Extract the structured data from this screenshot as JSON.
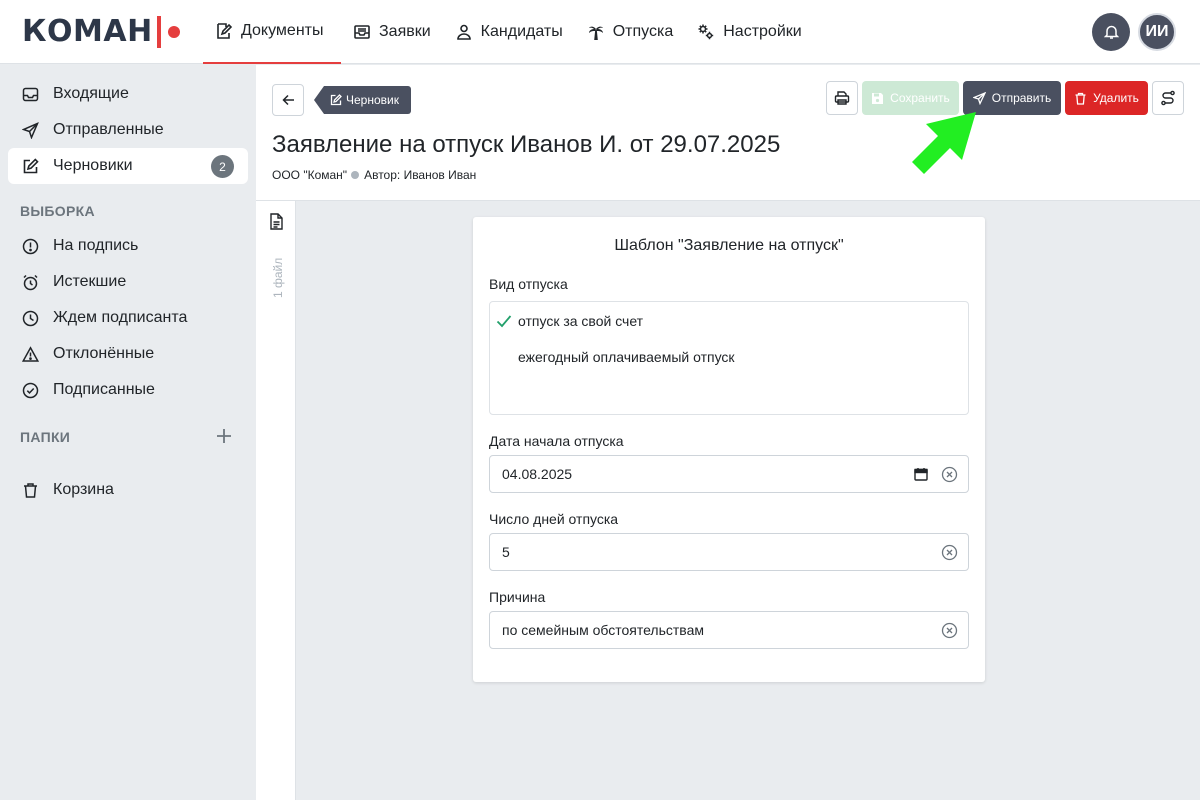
{
  "brand": {
    "logo_text": "КОМАН"
  },
  "nav": {
    "items": [
      {
        "label": "Документы",
        "icon": "document-edit-icon",
        "active": true
      },
      {
        "label": "Заявки",
        "icon": "inbox-icon"
      },
      {
        "label": "Кандидаты",
        "icon": "person-icon"
      },
      {
        "label": "Отпуска",
        "icon": "palm-tree-icon"
      },
      {
        "label": "Настройки",
        "icon": "gears-icon"
      }
    ]
  },
  "user": {
    "initials": "ИИ"
  },
  "sidebar": {
    "items": [
      {
        "label": "Входящие",
        "icon": "inbox-icon"
      },
      {
        "label": "Отправленные",
        "icon": "send-icon"
      },
      {
        "label": "Черновики",
        "icon": "draft-icon",
        "active": true,
        "count": "2"
      }
    ],
    "selection_title": "ВЫБОРКА",
    "selection_items": [
      {
        "label": "На подпись",
        "icon": "exclamation-circle-icon"
      },
      {
        "label": "Истекшие",
        "icon": "alarm-icon"
      },
      {
        "label": "Ждем подписанта",
        "icon": "clock-icon"
      },
      {
        "label": "Отклонённые",
        "icon": "warning-icon"
      },
      {
        "label": "Подписанные",
        "icon": "check-circle-icon"
      }
    ],
    "folders_title": "ПАПКИ",
    "trash_label": "Корзина"
  },
  "document": {
    "status_tag": "Черновик",
    "title": "Заявление на отпуск Иванов И. от 29.07.2025",
    "organization": "ООО \"Коман\"",
    "author": "Автор: Иванов Иван"
  },
  "toolbar": {
    "save_label": "Сохранить",
    "send_label": "Отправить",
    "delete_label": "Удалить"
  },
  "files": {
    "label": "1 файл"
  },
  "form": {
    "template_title": "Шаблон \"Заявление на отпуск\"",
    "vacation_type_label": "Вид отпуска",
    "vacation_type_options": [
      {
        "label": "отпуск за свой счет",
        "selected": true
      },
      {
        "label": "ежегодный оплачиваемый отпуск",
        "selected": false
      }
    ],
    "start_date_label": "Дата начала отпуска",
    "start_date_value": "04.08.2025",
    "days_label": "Число дней отпуска",
    "days_value": "5",
    "reason_label": "Причина",
    "reason_value": "по семейным обстоятельствам"
  },
  "colors": {
    "accent_red": "#e53e3e",
    "dark": "#4a5060",
    "success_light": "#cde9d5",
    "danger": "#dc2626",
    "hint_arrow": "#22ee22"
  }
}
